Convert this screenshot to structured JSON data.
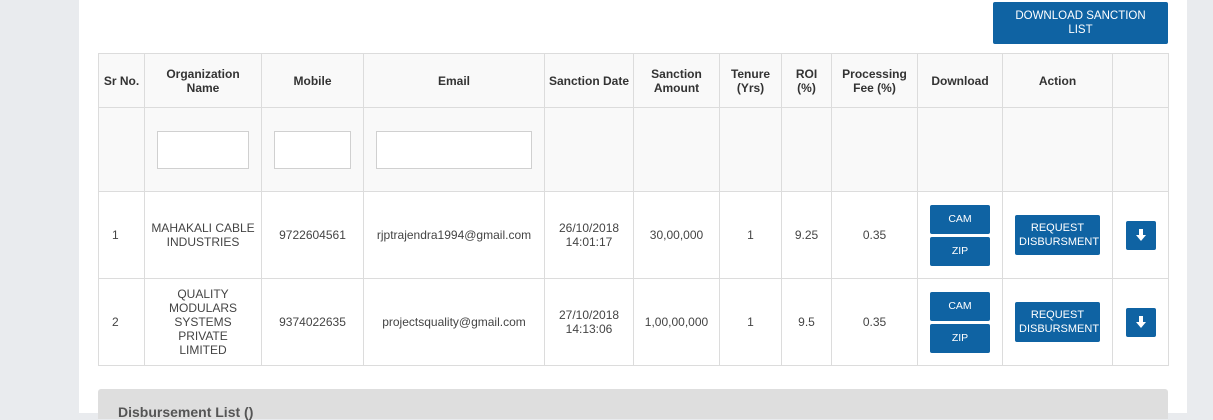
{
  "toolbar": {
    "download_label": "DOWNLOAD SANCTION LIST"
  },
  "table": {
    "columns": [
      "Sr No.",
      "Organization Name",
      "Mobile",
      "Email",
      "Sanction Date",
      "Sanction Amount",
      "Tenure (Yrs)",
      "ROI (%)",
      "Processing Fee (%)",
      "Download",
      "Action",
      ""
    ],
    "filters": {
      "organization": "",
      "mobile": "",
      "email": ""
    },
    "rows": [
      {
        "sr": "1",
        "organization": "MAHAKALI CABLE INDUSTRIES",
        "mobile": "9722604561",
        "email": "rjptrajendra1994@gmail.com",
        "sanction_date": "26/10/2018 14:01:17",
        "sanction_amount": "30,00,000",
        "tenure": "1",
        "roi": "9.25",
        "processing_fee": "0.35",
        "cam_label": "CAM",
        "zip_label": "ZIP",
        "action_label": "REQUEST DISBURSMENT"
      },
      {
        "sr": "2",
        "organization": "QUALITY MODULARS SYSTEMS PRIVATE LIMITED",
        "mobile": "9374022635",
        "email": "projectsquality@gmail.com",
        "sanction_date": "27/10/2018 14:13:06",
        "sanction_amount": "1,00,00,000",
        "tenure": "1",
        "roi": "9.5",
        "processing_fee": "0.35",
        "cam_label": "CAM",
        "zip_label": "ZIP",
        "action_label": "REQUEST DISBURSMENT"
      }
    ]
  },
  "disbursement": {
    "title": "Disbursement List ()"
  },
  "icons": {
    "row_download": "download-arrow-icon"
  },
  "colors": {
    "accent": "#0f63a3",
    "page_bg": "#e9ebee",
    "panel_bg": "#ffffff"
  }
}
